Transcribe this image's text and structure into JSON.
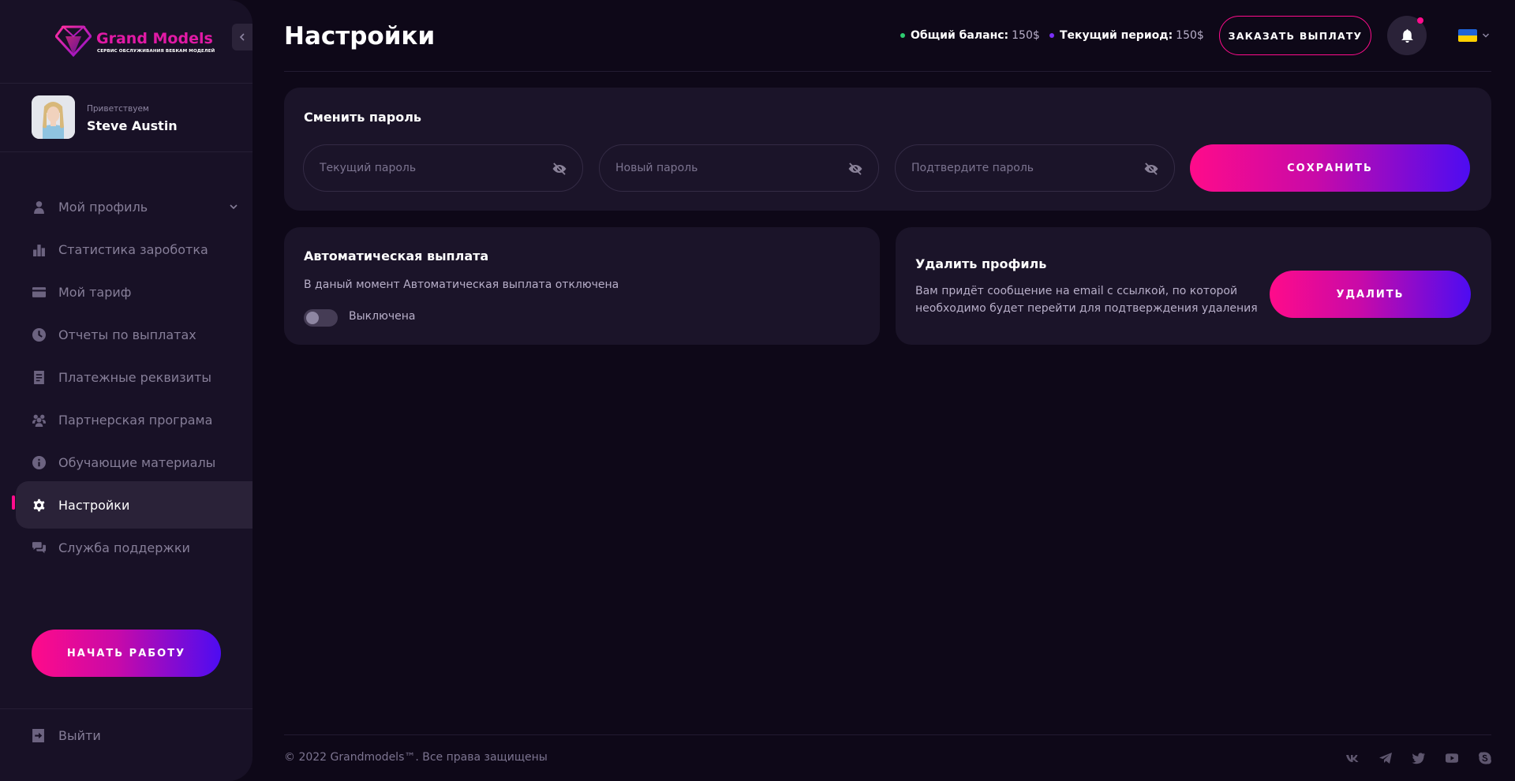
{
  "brand": {
    "name": "Grand Models",
    "tagline": "СЕРВИС ОБСЛУЖИВАНИЯ ВЕБКАМ МОДЕЛЕЙ",
    "accent": "#e11aa5"
  },
  "user": {
    "greeting": "Приветствуем",
    "name": "Steve Austin"
  },
  "sidebar": {
    "items": [
      {
        "label": "Мой профиль",
        "icon": "user-icon",
        "has_chevron": true,
        "active": false
      },
      {
        "label": "Статистика зароботка",
        "icon": "bar-chart-icon",
        "active": false
      },
      {
        "label": "Мой тариф",
        "icon": "credit-card-icon",
        "active": false
      },
      {
        "label": "Отчеты по выплатах",
        "icon": "clock-icon",
        "active": false
      },
      {
        "label": "Платежные реквизиты",
        "icon": "document-icon",
        "active": false
      },
      {
        "label": "Партнерская програма",
        "icon": "users-icon",
        "active": false
      },
      {
        "label": "Обучающие материалы",
        "icon": "info-icon",
        "active": false
      },
      {
        "label": "Настройки",
        "icon": "gear-icon",
        "active": true
      },
      {
        "label": "Служба поддержки",
        "icon": "chat-icon",
        "active": false
      }
    ],
    "start_button": "НАЧАТЬ РАБОТУ",
    "logout": "Выйти"
  },
  "header": {
    "title": "Настройки",
    "balance_label": "Общий баланс:",
    "balance_value": "150$",
    "period_label": "Текущий период:",
    "period_value": "150$",
    "payout_button": "ЗАКАЗАТЬ ВЫПЛАТУ",
    "language_flag": "ukraine-flag-icon"
  },
  "change_password": {
    "title": "Сменить пароль",
    "current_placeholder": "Текущий пароль",
    "new_placeholder": "Новый пароль",
    "confirm_placeholder": "Подтвердите пароль",
    "save_button": "СОХРАНИТЬ"
  },
  "auto_payout": {
    "title": "Автоматическая выплата",
    "description": "В даный момент Автоматическая выплата отключена",
    "toggle_label": "Выключена",
    "enabled": false
  },
  "delete_profile": {
    "title": "Удалить профиль",
    "description_line1": "Вам придёт сообщение на email с ссылкой, по которой",
    "description_line2": "необходимо будет перейти для подтверждения удаления",
    "button": "УДАЛИТЬ"
  },
  "footer": {
    "copyright": "© 2022 Grandmodels™. Все права защищены",
    "socials": [
      "vk-icon",
      "telegram-icon",
      "twitter-icon",
      "youtube-icon",
      "skype-icon"
    ]
  },
  "colors": {
    "background": "#0e0818",
    "sidebar": "#181126",
    "card": "#1b1429",
    "accent_pink": "#ff0c8c",
    "accent_purple": "#4d0cf2",
    "balance_dot": "#2ecc71",
    "period_dot": "#7b2ff7"
  }
}
